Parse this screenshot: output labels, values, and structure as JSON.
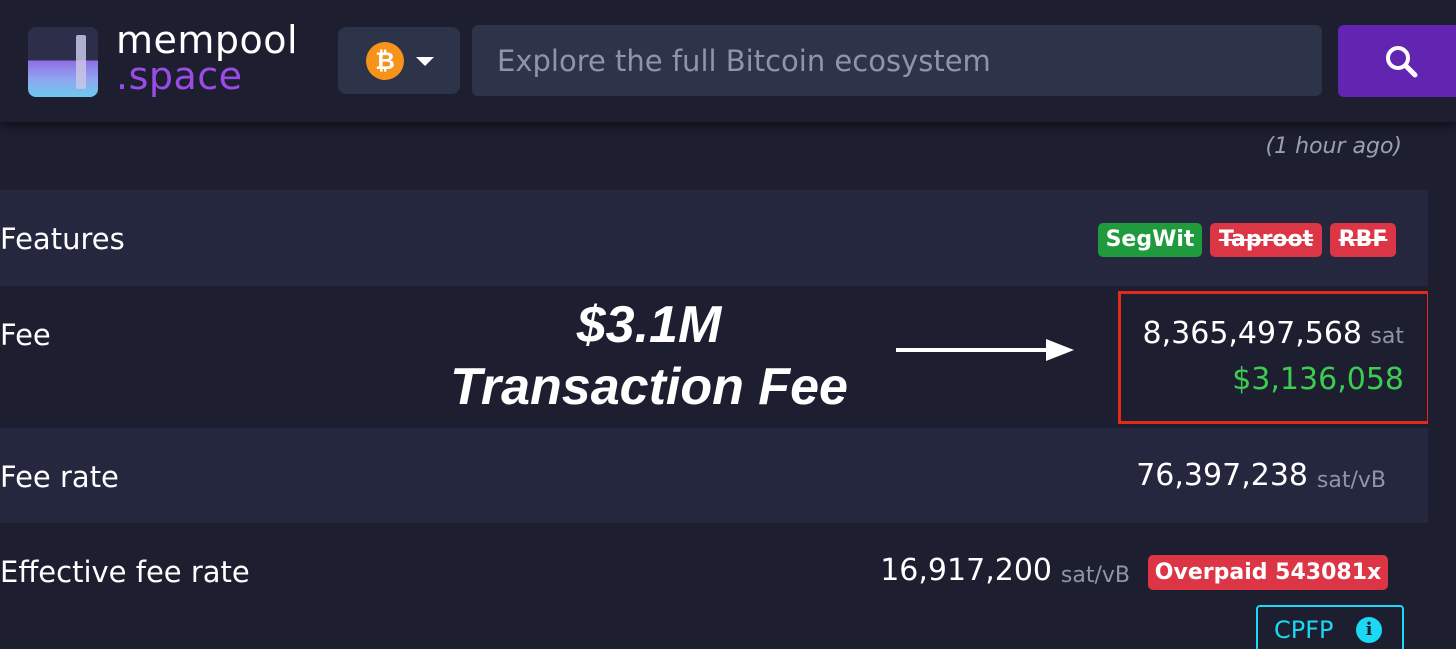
{
  "header": {
    "logo_line1": "mempool",
    "logo_line2": ".space",
    "network_icon_glyph": "₿",
    "search_placeholder": "Explore the full Bitcoin ecosystem",
    "colors": {
      "brand_purple": "#9b4ce8",
      "search_button": "#6225b2",
      "bitcoin_orange": "#f7931a"
    }
  },
  "transaction": {
    "time_ago": "(1 hour ago)",
    "features": {
      "label": "Features",
      "badges": [
        "SegWit",
        "Taproot",
        "RBF"
      ]
    },
    "fee": {
      "label": "Fee",
      "sat_value": "8,365,497,568",
      "sat_unit": "sat",
      "usd_value": "$3,136,058"
    },
    "fee_rate": {
      "label": "Fee rate",
      "value": "76,397,238",
      "unit": "sat/vB"
    },
    "effective_fee_rate": {
      "label": "Effective fee rate",
      "value": "16,917,200",
      "unit": "sat/vB",
      "overpaid_badge": "Overpaid 543081x",
      "cpfp_label": "CPFP",
      "info_glyph": "i"
    }
  },
  "annotation": {
    "line1": "$3.1M",
    "line2": "Transaction Fee"
  }
}
